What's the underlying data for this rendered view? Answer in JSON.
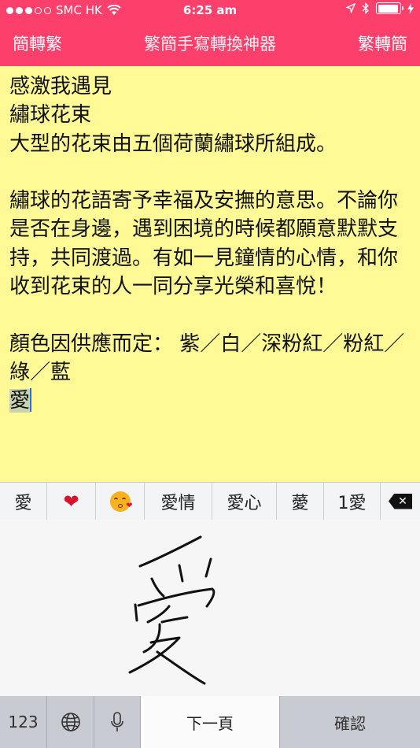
{
  "status_bar": {
    "carrier": "SMC HK",
    "time": "6:25 am"
  },
  "nav": {
    "left_button": "簡轉繁",
    "title": "繁簡手寫轉換神器",
    "right_button": "繁轉簡"
  },
  "editor": {
    "lines": [
      "感激我遇見",
      "繡球花束",
      "大型的花束由五個荷蘭繡球所組成。",
      "",
      "繡球的花語寄予幸福及安撫的意思。不論你是否在身邊，遇到困境的時候都願意默默支持，共同渡過。有如一見鐘情的心情，和你收到花束的人一同分享光榮和喜悅！",
      "",
      "顏色因供應而定： 紫／白／深粉紅／粉紅／綠／藍"
    ],
    "selected_text": "愛"
  },
  "suggestions": {
    "items": [
      "愛",
      "heart-emoji",
      "kiss-emoji",
      "愛情",
      "愛心",
      "薆",
      "1愛"
    ]
  },
  "keyboard": {
    "numbers_label": "123",
    "next_page_label": "下一頁",
    "confirm_label": "確認"
  },
  "colors": {
    "accent": "#fd3f6c",
    "editor_bg": "#fffa96"
  }
}
